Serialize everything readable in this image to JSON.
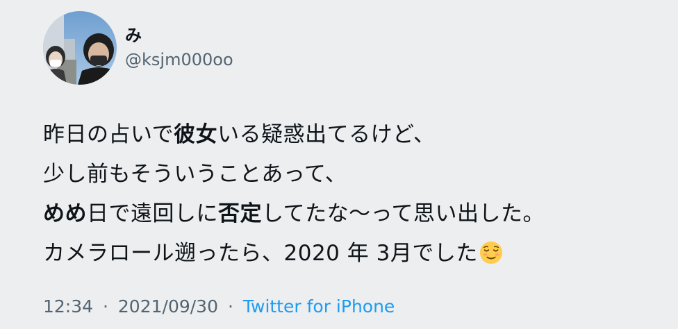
{
  "user": {
    "display_name": "み",
    "handle": "@ksjm000oo"
  },
  "tweet": {
    "lines": [
      [
        {
          "text": "昨日の占いで",
          "bold": false
        },
        {
          "text": "彼女",
          "bold": true
        },
        {
          "text": "いる疑惑出てるけど、",
          "bold": false
        }
      ],
      [
        {
          "text": "少し前もそういうことあって、",
          "bold": false
        }
      ],
      [
        {
          "text": "めめ",
          "bold": true
        },
        {
          "text": "日で遠回しに",
          "bold": false
        },
        {
          "text": "否定",
          "bold": true
        },
        {
          "text": "してたな〜って思い出した。",
          "bold": false
        }
      ],
      [
        {
          "text": "カメラロール遡ったら、2020 年 3月でした",
          "bold": false
        }
      ]
    ],
    "emoji": "relieved-face"
  },
  "meta": {
    "time": "12:34",
    "separator": "·",
    "date": "2021/09/30",
    "source": "Twitter for iPhone"
  },
  "colors": {
    "background": "#eceef0",
    "text": "#0f1419",
    "secondary": "#536471",
    "link": "#1d9bf0"
  }
}
